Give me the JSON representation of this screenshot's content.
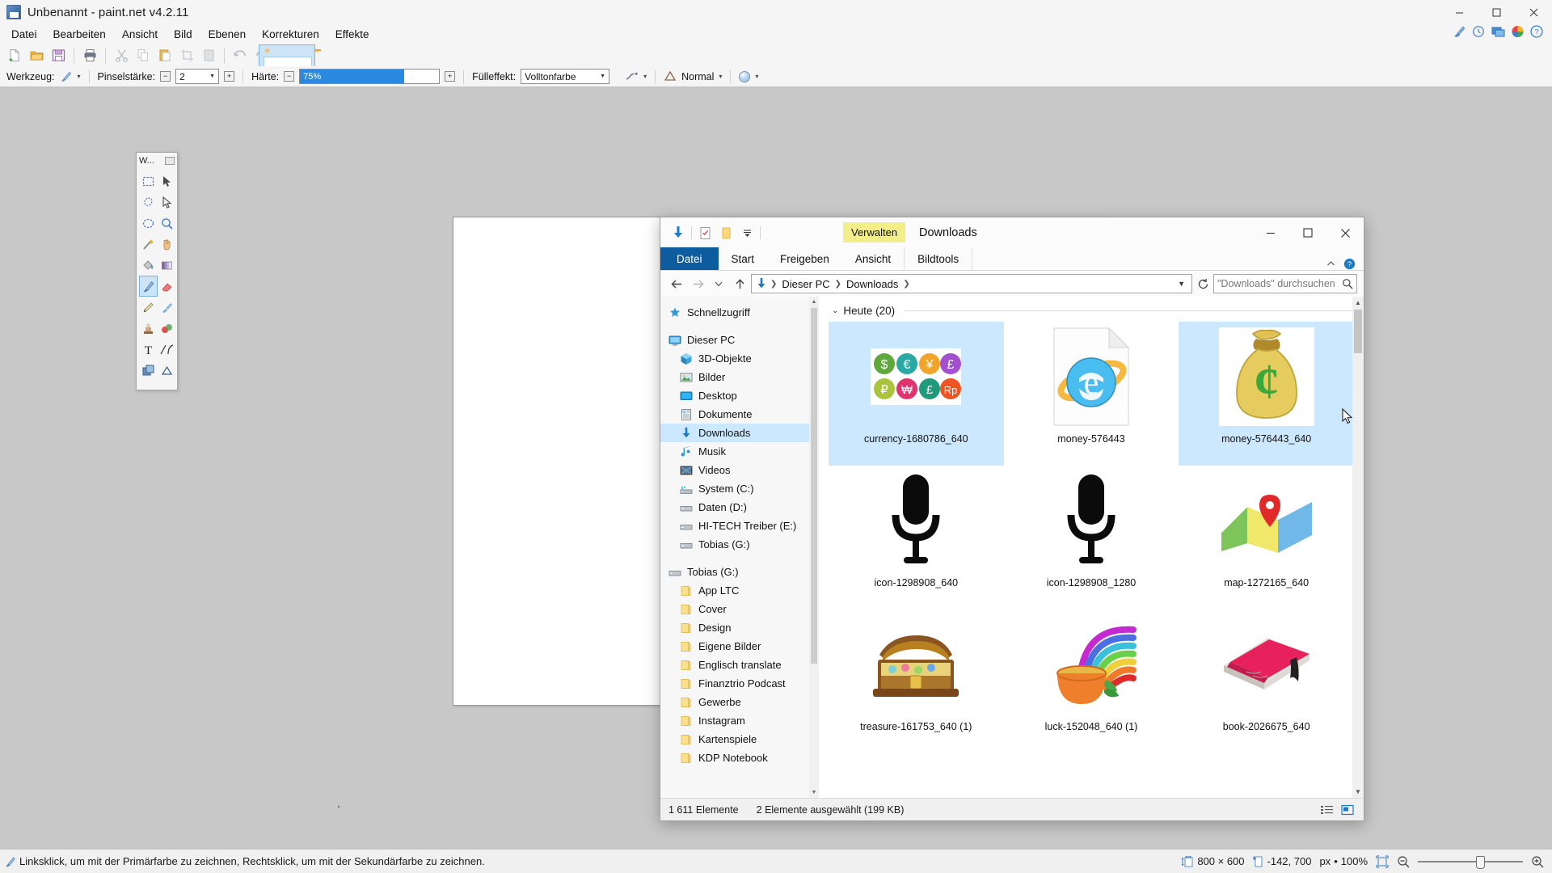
{
  "paintnet": {
    "title": "Unbenannt - paint.net v4.2.11",
    "title_icon": "paintnet-app-icon",
    "window_buttons": [
      {
        "name": "minimize-button",
        "glyph": "minimize-icon"
      },
      {
        "name": "maximize-button",
        "glyph": "maximize-icon"
      },
      {
        "name": "close-button",
        "glyph": "close-icon"
      }
    ],
    "menus": [
      "Datei",
      "Bearbeiten",
      "Ansicht",
      "Bild",
      "Ebenen",
      "Korrekturen",
      "Effekte"
    ],
    "toolbar_icons": [
      "new-file-icon",
      "open-folder-icon",
      "save-icon",
      "print-icon",
      "cut-scissors-icon",
      "copy-icon",
      "paste-icon",
      "crop-icon",
      "deselect-icon",
      "undo-icon",
      "redo-icon",
      "grid-icon",
      "rulers-icon"
    ],
    "toolbar_right_icons": [
      "settings-brush-icon",
      "history-icon",
      "layers-icon",
      "palette-icon",
      "help-icon"
    ],
    "options": {
      "tool_label": "Werkzeug:",
      "tool_icon": "paintbrush-icon",
      "brush_width_label": "Pinselstärke:",
      "brush_width_value": "2",
      "hardness_label": "Härte:",
      "hardness_value": "75%",
      "hardness_percent": 75,
      "fill_label": "Fülleffekt:",
      "fill_value": "Volltonfarbe",
      "antialias_icon": "antialiasing-icon",
      "blend_icon": "blend-mode-icon",
      "blend_value": "Normal",
      "palette_icon": "color-wheel-icon"
    },
    "tools_palette": {
      "title": "W...",
      "tools": [
        {
          "name": "rectangle-select-tool",
          "icon": "rect-select-icon",
          "active": false
        },
        {
          "name": "move-selected-tool",
          "icon": "move-arrow-icon",
          "active": false
        },
        {
          "name": "lasso-select-tool",
          "icon": "lasso-icon",
          "active": false
        },
        {
          "name": "move-selection-tool",
          "icon": "move-selection-icon",
          "active": false
        },
        {
          "name": "ellipse-select-tool",
          "icon": "ellipse-select-icon",
          "active": false
        },
        {
          "name": "zoom-tool",
          "icon": "magnifier-icon",
          "active": false
        },
        {
          "name": "magic-wand-tool",
          "icon": "magic-wand-icon",
          "active": false
        },
        {
          "name": "pan-tool",
          "icon": "hand-icon",
          "active": false
        },
        {
          "name": "paint-bucket-tool",
          "icon": "paint-bucket-icon",
          "active": false
        },
        {
          "name": "gradient-tool",
          "icon": "gradient-icon",
          "active": false
        },
        {
          "name": "paintbrush-tool",
          "icon": "paintbrush-icon",
          "active": true
        },
        {
          "name": "eraser-tool",
          "icon": "eraser-icon",
          "active": false
        },
        {
          "name": "pencil-tool",
          "icon": "pencil-icon",
          "active": false
        },
        {
          "name": "color-picker-tool",
          "icon": "eyedropper-icon",
          "active": false
        },
        {
          "name": "clone-stamp-tool",
          "icon": "clone-stamp-icon",
          "active": false
        },
        {
          "name": "recolor-tool",
          "icon": "recolor-icon",
          "active": false
        },
        {
          "name": "text-tool",
          "icon": "text-icon",
          "active": false
        },
        {
          "name": "line-curve-tool",
          "icon": "line-curve-icon",
          "active": false
        },
        {
          "name": "shapes-tool",
          "icon": "shapes-icon",
          "active": false
        },
        {
          "name": "shapes-more-tool",
          "icon": "shapes-triangle-icon",
          "active": false
        }
      ]
    },
    "status": {
      "hint_icon": "paintbrush-small-icon",
      "hint": "Linksklick, um mit der Primärfarbe zu zeichnen, Rechtsklick, um mit der Sekundärfarbe zu zeichnen.",
      "image_size_icon": "image-size-icon",
      "image_size": "800 × 600",
      "cursor_pos_icon": "cursor-position-icon",
      "cursor_pos": "-142, 700",
      "unit": "px",
      "unit_separator": "•",
      "zoom_level": "100%",
      "fit_icon": "fit-to-window-icon",
      "zoom_out_icon": "zoom-out-icon",
      "zoom_in_icon": "zoom-in-icon"
    }
  },
  "explorer": {
    "title": "Downloads",
    "contextual_tab_group": "Verwalten",
    "quick_access": [
      {
        "name": "downloads-folder-icon",
        "icon": "blue-down-arrow"
      },
      {
        "name": "properties-icon",
        "icon": "checked-document"
      },
      {
        "name": "new-folder-icon",
        "icon": "yellow-folder"
      },
      {
        "name": "customize-qat-icon",
        "icon": "chevron-down-bar"
      }
    ],
    "window_buttons": [
      {
        "name": "minimize-button",
        "glyph": "minimize-icon"
      },
      {
        "name": "maximize-button",
        "glyph": "maximize-icon"
      },
      {
        "name": "close-button",
        "glyph": "close-icon"
      }
    ],
    "tabs": [
      {
        "label": "Datei",
        "type": "file"
      },
      {
        "label": "Start",
        "type": "normal"
      },
      {
        "label": "Freigeben",
        "type": "normal"
      },
      {
        "label": "Ansicht",
        "type": "normal"
      },
      {
        "label": "Bildtools",
        "type": "contextual"
      }
    ],
    "help_icon": "help-question-icon",
    "collapse_ribbon_icon": "chevron-up-icon",
    "address": {
      "back_icon": "arrow-left-icon",
      "forward_icon": "arrow-right-icon",
      "recent_icon": "chevron-down-icon",
      "up_icon": "arrow-up-icon",
      "root_icon": "downloads-arrow-icon",
      "crumbs": [
        "Dieser PC",
        "Downloads"
      ],
      "dropdown_icon": "chevron-down-icon",
      "refresh_icon": "refresh-icon"
    },
    "search": {
      "placeholder": "\"Downloads\" durchsuchen",
      "icon": "search-icon"
    },
    "sidebar": [
      {
        "label": "Schnellzugriff",
        "icon": "star-pin-icon",
        "indent": 0,
        "selected": false
      },
      {
        "label": "",
        "icon": "",
        "indent": 0,
        "selected": false,
        "spacer": true
      },
      {
        "label": "Dieser PC",
        "icon": "computer-icon",
        "indent": 0,
        "selected": false
      },
      {
        "label": "3D-Objekte",
        "icon": "3d-objects-icon",
        "indent": 1,
        "selected": false
      },
      {
        "label": "Bilder",
        "icon": "pictures-icon",
        "indent": 1,
        "selected": false
      },
      {
        "label": "Desktop",
        "icon": "desktop-icon",
        "indent": 1,
        "selected": false
      },
      {
        "label": "Dokumente",
        "icon": "documents-icon",
        "indent": 1,
        "selected": false
      },
      {
        "label": "Downloads",
        "icon": "downloads-icon",
        "indent": 1,
        "selected": true
      },
      {
        "label": "Musik",
        "icon": "music-icon",
        "indent": 1,
        "selected": false
      },
      {
        "label": "Videos",
        "icon": "videos-icon",
        "indent": 1,
        "selected": false
      },
      {
        "label": "System (C:)",
        "icon": "system-drive-icon",
        "indent": 1,
        "selected": false
      },
      {
        "label": "Daten (D:)",
        "icon": "drive-icon",
        "indent": 1,
        "selected": false
      },
      {
        "label": "HI-TECH Treiber (E:)",
        "icon": "drive-icon",
        "indent": 1,
        "selected": false
      },
      {
        "label": "Tobias (G:)",
        "icon": "drive-icon",
        "indent": 1,
        "selected": false
      },
      {
        "label": "",
        "icon": "",
        "indent": 0,
        "selected": false,
        "spacer": true
      },
      {
        "label": "Tobias (G:)",
        "icon": "drive-icon",
        "indent": 0,
        "selected": false
      },
      {
        "label": "App LTC",
        "icon": "folder-icon",
        "indent": 1,
        "selected": false
      },
      {
        "label": "Cover",
        "icon": "folder-icon",
        "indent": 1,
        "selected": false
      },
      {
        "label": "Design",
        "icon": "folder-icon",
        "indent": 1,
        "selected": false
      },
      {
        "label": "Eigene Bilder",
        "icon": "folder-icon",
        "indent": 1,
        "selected": false
      },
      {
        "label": "Englisch translate",
        "icon": "folder-icon",
        "indent": 1,
        "selected": false
      },
      {
        "label": "Finanztrio Podcast",
        "icon": "folder-icon",
        "indent": 1,
        "selected": false
      },
      {
        "label": "Gewerbe",
        "icon": "folder-icon",
        "indent": 1,
        "selected": false
      },
      {
        "label": "Instagram",
        "icon": "folder-icon",
        "indent": 1,
        "selected": false
      },
      {
        "label": "Kartenspiele",
        "icon": "folder-icon",
        "indent": 1,
        "selected": false
      },
      {
        "label": "KDP Notebook",
        "icon": "folder-icon",
        "indent": 1,
        "selected": false
      }
    ],
    "group_header": {
      "label": "Heute (20)",
      "chevron": "chevron-down-icon"
    },
    "files": [
      {
        "label": "currency-1680786_640",
        "thumb": "currency-coins-thumb",
        "selected": true
      },
      {
        "label": "money-576443",
        "thumb": "internet-explorer-document-thumb",
        "selected": false
      },
      {
        "label": "money-576443_640",
        "thumb": "money-bag-thumb",
        "selected": true
      },
      {
        "label": "icon-1298908_640",
        "thumb": "microphone-thumb",
        "selected": false
      },
      {
        "label": "icon-1298908_1280",
        "thumb": "microphone-thumb",
        "selected": false
      },
      {
        "label": "map-1272165_640",
        "thumb": "map-pin-thumb",
        "selected": false
      },
      {
        "label": "treasure-161753_640 (1)",
        "thumb": "treasure-chest-thumb",
        "selected": false
      },
      {
        "label": "luck-152048_640 (1)",
        "thumb": "pot-of-gold-thumb",
        "selected": false
      },
      {
        "label": "book-2026675_640",
        "thumb": "book-thumb",
        "selected": false
      }
    ],
    "status": {
      "item_count": "1 611 Elemente",
      "selection": "2 Elemente ausgewählt (199 KB)",
      "view_details_icon": "details-view-icon",
      "view_large_icons_icon": "large-icons-view-icon"
    }
  },
  "colors": {
    "accent_blue": "#0c5c9e",
    "selection_blue": "#cce8ff",
    "contextual_yellow": "#f2ef8b",
    "desktop_gray": "#c8c8c8",
    "slider_blue": "#2b8ae0"
  }
}
